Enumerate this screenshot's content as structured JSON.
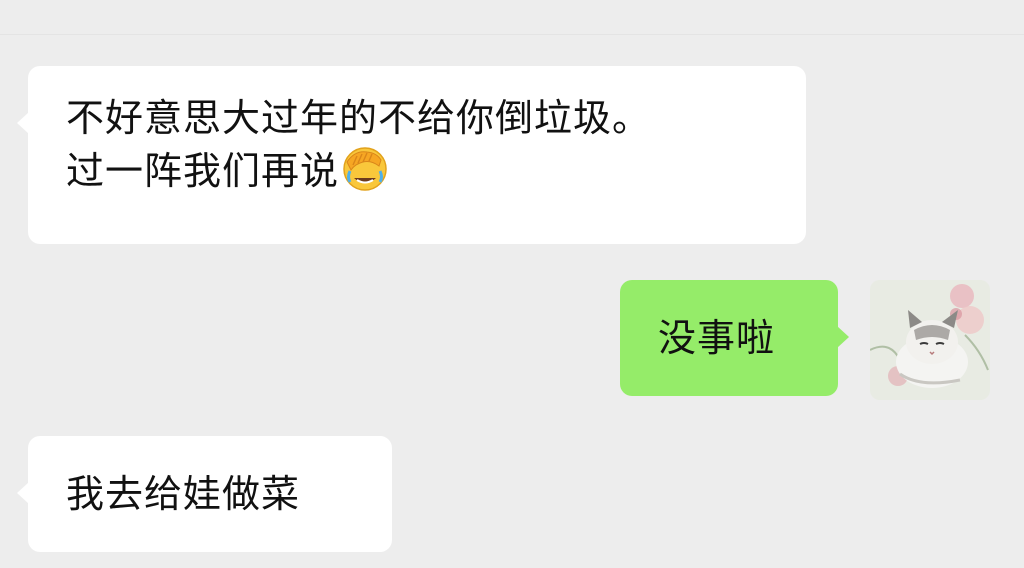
{
  "chat": {
    "messages": [
      {
        "direction": "incoming",
        "lines": [
          "不好意思大过年的不给你倒垃圾。",
          "过一阵我们再说"
        ],
        "emoji": "face-palm-crying-emoji"
      },
      {
        "direction": "outgoing",
        "text": "没事啦",
        "avatar_icon": "cat-avatar"
      },
      {
        "direction": "incoming",
        "text": "我去给娃做菜"
      }
    ]
  },
  "colors": {
    "background": "#ededed",
    "incoming_bubble": "#ffffff",
    "outgoing_bubble": "#95ec69",
    "text": "#111111"
  }
}
